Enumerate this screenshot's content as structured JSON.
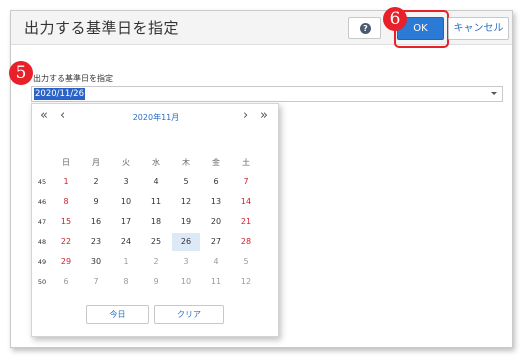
{
  "dialog": {
    "title": "出力する基準日を指定",
    "help_icon": "question-icon",
    "ok_label": "OK",
    "cancel_label": "キャンセル"
  },
  "annotations": {
    "badge5": "5",
    "badge6": "6"
  },
  "field": {
    "label": "出力する基準日を指定",
    "value": "2020/11/26"
  },
  "calendar": {
    "month_label": "2020年11月",
    "nav": {
      "prev_year": "«",
      "prev_month": "‹",
      "next_month": "›",
      "next_year": "»"
    },
    "weekdays": [
      "日",
      "月",
      "火",
      "水",
      "木",
      "金",
      "土"
    ],
    "weeks": [
      {
        "num": "45",
        "days": [
          "1",
          "2",
          "3",
          "4",
          "5",
          "6",
          "7"
        ]
      },
      {
        "num": "46",
        "days": [
          "8",
          "9",
          "10",
          "11",
          "12",
          "13",
          "14"
        ]
      },
      {
        "num": "47",
        "days": [
          "15",
          "16",
          "17",
          "18",
          "19",
          "20",
          "21"
        ]
      },
      {
        "num": "48",
        "days": [
          "22",
          "23",
          "24",
          "25",
          "26",
          "27",
          "28"
        ]
      },
      {
        "num": "49",
        "days": [
          "29",
          "30",
          "1",
          "2",
          "3",
          "4",
          "5"
        ]
      },
      {
        "num": "50",
        "days": [
          "6",
          "7",
          "8",
          "9",
          "10",
          "11",
          "12"
        ]
      }
    ],
    "selected_day": "26",
    "today_label": "今日",
    "clear_label": "クリア"
  },
  "colors": {
    "accent": "#2b7bd6",
    "holiday_red": "#d0202a",
    "highlight": "#e8202a"
  }
}
